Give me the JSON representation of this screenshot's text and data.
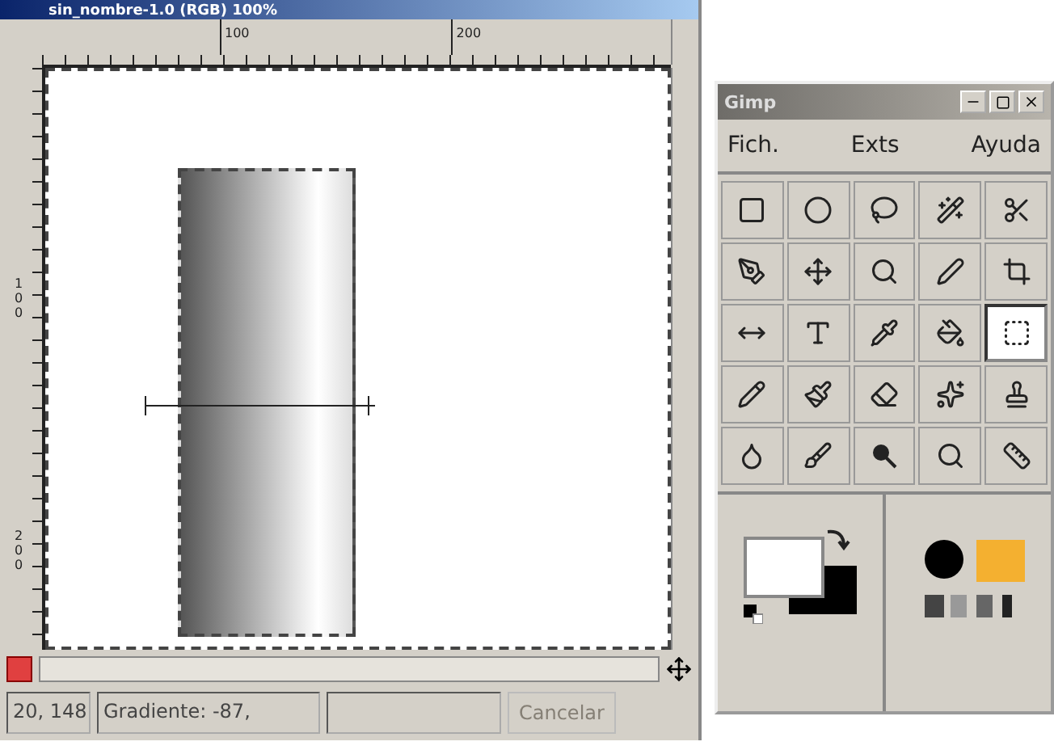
{
  "image_window": {
    "title": "sin_nombre-1.0 (RGB) 100%",
    "hruler": [
      "100",
      "200"
    ],
    "vruler": [
      "100",
      "200"
    ],
    "status_bar": {
      "coords": "20, 148",
      "message": "Gradiente: -87,",
      "button": {
        "label": "Cancelar",
        "disabled": true
      }
    }
  },
  "toolbox": {
    "title": "Gimp",
    "menu": [
      "Fich.",
      "Exts",
      "Ayuda"
    ],
    "tools": [
      {
        "selected": false
      },
      {
        "selected": false
      },
      {
        "selected": false
      },
      {
        "selected": false
      },
      {
        "selected": false
      },
      {
        "selected": false
      },
      {
        "selected": false
      },
      {
        "selected": false
      },
      {
        "selected": false
      },
      {
        "selected": false
      },
      {
        "selected": false
      },
      {
        "selected": false
      },
      {
        "selected": false
      },
      {
        "selected": false
      },
      {
        "selected": true
      },
      {
        "selected": false
      },
      {
        "selected": false
      },
      {
        "selected": false
      },
      {
        "selected": false
      },
      {
        "selected": false
      },
      {
        "selected": false
      },
      {
        "selected": false
      },
      {
        "selected": false
      },
      {
        "selected": false
      },
      {
        "selected": false
      }
    ]
  }
}
